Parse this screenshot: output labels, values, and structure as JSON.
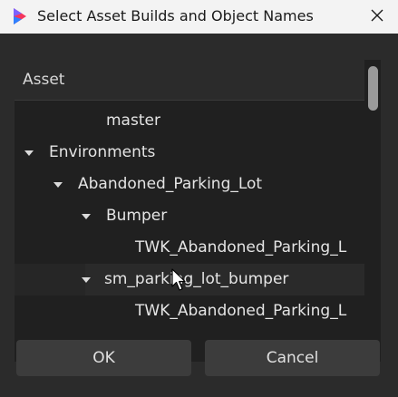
{
  "window": {
    "title": "Select Asset Builds and Object Names",
    "icon": "app-logo-icon",
    "close_icon": "close-icon"
  },
  "tree": {
    "header": "Asset",
    "rows": [
      {
        "label": "master",
        "level": 3,
        "expanded": null
      },
      {
        "label": "Environments",
        "level": 0,
        "expanded": true
      },
      {
        "label": "Abandoned_Parking_Lot",
        "level": 1,
        "expanded": true
      },
      {
        "label": "Bumper",
        "level": 2,
        "expanded": true
      },
      {
        "label": "TWK_Abandoned_Parking_L",
        "level": 4,
        "expanded": null
      },
      {
        "label": "sm_parking_lot_bumper",
        "level": 2,
        "expanded": true,
        "hovered": true
      },
      {
        "label": "TWK_Abandoned_Parking_L",
        "level": 4,
        "expanded": null
      }
    ]
  },
  "buttons": {
    "ok": "OK",
    "cancel": "Cancel"
  },
  "colors": {
    "background": "#2b2b2b",
    "tree_background": "#202020",
    "button": "#3c3c3c",
    "titlebar": "#f3f3f3",
    "text": "#e4e4e4"
  }
}
